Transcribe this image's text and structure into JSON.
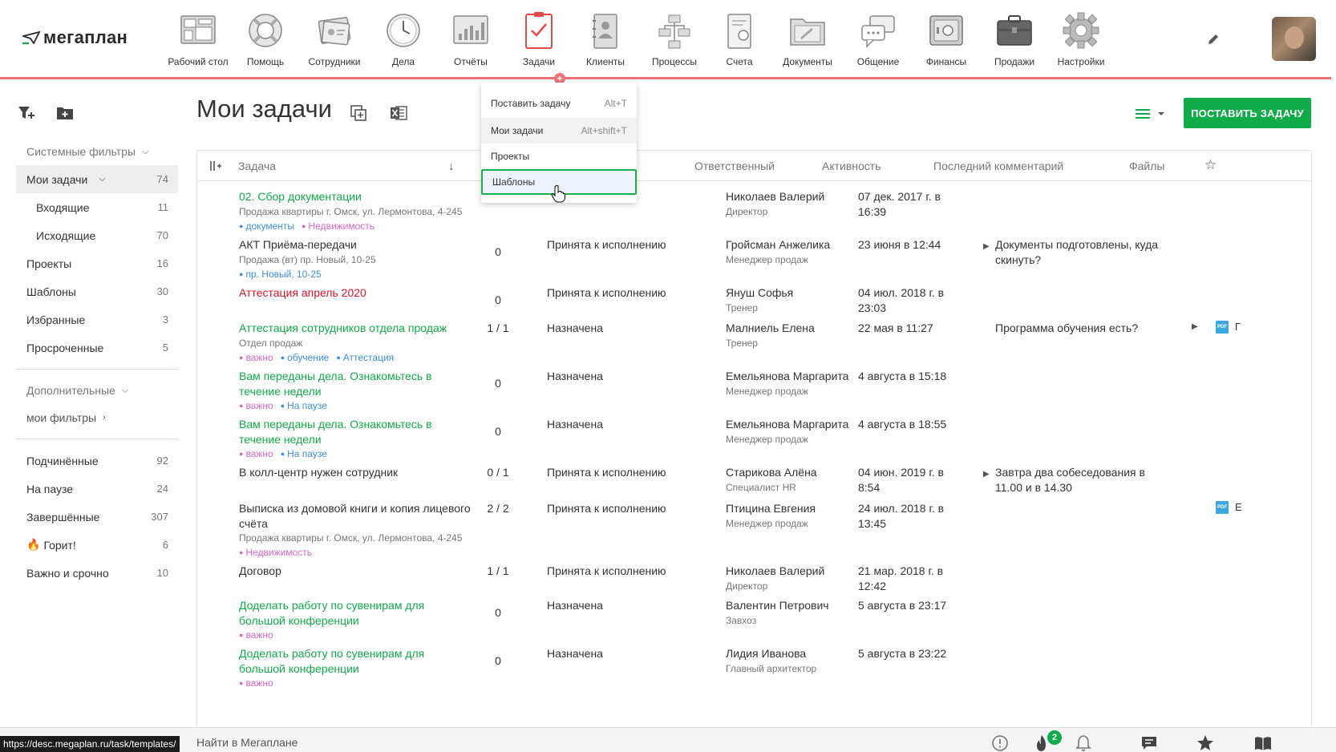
{
  "app": {
    "logo_text": "мегаплан"
  },
  "nav": [
    {
      "label": "Рабочий стол",
      "icon": "desktop-icon"
    },
    {
      "label": "Помощь",
      "icon": "lifebuoy-icon"
    },
    {
      "label": "Сотрудники",
      "icon": "employees-icon"
    },
    {
      "label": "Дела",
      "icon": "clock-icon"
    },
    {
      "label": "Отчёты",
      "icon": "reports-icon"
    },
    {
      "label": "Задачи",
      "icon": "tasks-icon"
    },
    {
      "label": "Клиенты",
      "icon": "clients-icon"
    },
    {
      "label": "Процессы",
      "icon": "processes-icon"
    },
    {
      "label": "Счета",
      "icon": "invoices-icon"
    },
    {
      "label": "Документы",
      "icon": "documents-icon"
    },
    {
      "label": "Общение",
      "icon": "chat-icon"
    },
    {
      "label": "Финансы",
      "icon": "safe-icon"
    },
    {
      "label": "Продажи",
      "icon": "briefcase-icon"
    },
    {
      "label": "Настройки",
      "icon": "gear-icon"
    }
  ],
  "sidebar": {
    "system_filters": "Системные фильтры",
    "my_tasks": {
      "label": "Мои задачи",
      "count": "74"
    },
    "inbox": {
      "label": "Входящие",
      "count": "11"
    },
    "outbox": {
      "label": "Исходящие",
      "count": "70"
    },
    "projects": {
      "label": "Проекты",
      "count": "16"
    },
    "templates": {
      "label": "Шаблоны",
      "count": "30"
    },
    "favorites": {
      "label": "Избранные",
      "count": "3"
    },
    "overdue": {
      "label": "Просроченные",
      "count": "5"
    },
    "extra": "Дополнительные",
    "my_filters": "мои фильтры",
    "subordinates": {
      "label": "Подчинённые",
      "count": "92"
    },
    "paused": {
      "label": "На паузе",
      "count": "24"
    },
    "done": {
      "label": "Завершённые",
      "count": "307"
    },
    "burning": {
      "label": "Горит!",
      "count": "6"
    },
    "urgent": {
      "label": "Важно и срочно",
      "count": "10"
    }
  },
  "header": {
    "title": "Мои задачи",
    "add_button": "ПОСТАВИТЬ ЗАДАЧУ"
  },
  "columns": {
    "task": "Задача",
    "responsible": "Ответственный",
    "activity": "Активность",
    "last_comment": "Последний комментарий",
    "files": "Файлы"
  },
  "dropdown": [
    {
      "label": "Поставить задачу",
      "hotkey": "Alt+T"
    },
    {
      "label": "Мои задачи",
      "hotkey": "Alt+shift+T"
    },
    {
      "label": "Проекты",
      "hotkey": ""
    },
    {
      "label": "Шаблоны",
      "hotkey": ""
    }
  ],
  "rows": [
    {
      "title": "02. Сбор документации",
      "style": "green",
      "sub": "Продажа квартиры г. Омск, ул. Лермонтова, 4-245",
      "tags": [
        {
          "t": "документы",
          "c": "blue"
        },
        {
          "t": "Недвижимость",
          "c": "pink"
        }
      ],
      "subtasks": "",
      "status": "",
      "resp": "Николаев Валерий",
      "role": "Директор",
      "act": "07 дек. 2017 г. в 16:39",
      "comment": "",
      "file": ""
    },
    {
      "title": "АКТ Приёма-передачи",
      "style": "",
      "sub": "Продажа (вт) пр. Новый, 10-25",
      "tags": [
        {
          "t": "пр. Новый, 10-25",
          "c": "blue"
        }
      ],
      "subtasks": "0",
      "status": "Принята к исполнению",
      "resp": "Гройсман Анжелика",
      "role": "Менеджер продаж",
      "act": "23 июня в 12:44",
      "comment": "Документы подготовлены, куда скинуть?",
      "file": ""
    },
    {
      "title": "Аттестация апрель 2020",
      "style": "red",
      "sub": "",
      "tags": [],
      "subtasks": "0",
      "status": "Принята к исполнению",
      "resp": "Януш Софья",
      "role": "Тренер",
      "act": "04 июл. 2018 г. в 23:03",
      "comment": "",
      "file": ""
    },
    {
      "title": "Аттестация сотрудников отдела продаж",
      "style": "green",
      "sub": "Отдел продаж",
      "tags": [
        {
          "t": "важно",
          "c": "pink"
        },
        {
          "t": "обучение",
          "c": "blue"
        },
        {
          "t": "Аттестация",
          "c": "blue"
        }
      ],
      "subtasks": "1 / 1",
      "status": "Назначена",
      "resp": "Малниель Елена",
      "role": "Тренер",
      "act": "22 мая в 11:27",
      "comment": "Программа обучения есть?",
      "file": "Г"
    },
    {
      "title": "Вам переданы дела. Ознакомьтесь в течение недели",
      "style": "green",
      "sub": "",
      "tags": [
        {
          "t": "важно",
          "c": "pink"
        },
        {
          "t": "На паузе",
          "c": "blue"
        }
      ],
      "subtasks": "0",
      "status": "Назначена",
      "resp": "Емельянова Маргарита",
      "role": "Менеджер продаж",
      "act": "4 августа в 15:18",
      "comment": "",
      "file": ""
    },
    {
      "title": "Вам переданы дела. Ознакомьтесь в течение недели",
      "style": "green",
      "sub": "",
      "tags": [
        {
          "t": "важно",
          "c": "pink"
        },
        {
          "t": "На паузе",
          "c": "blue"
        }
      ],
      "subtasks": "0",
      "status": "Назначена",
      "resp": "Емельянова Маргарита",
      "role": "Менеджер продаж",
      "act": "4 августа в 18:55",
      "comment": "",
      "file": ""
    },
    {
      "title": "В колл-центр нужен сотрудник",
      "style": "",
      "sub": "",
      "tags": [],
      "subtasks": "0 / 1",
      "status": "Принята к исполнению",
      "resp": "Старикова Алёна",
      "role": "Специалист HR",
      "act": "04 июн. 2019 г. в 8:54",
      "comment": "Завтра два собеседования в 11.00 и в 14.30",
      "file": ""
    },
    {
      "title": "Выписка из домовой книги и копия лицевого счёта",
      "style": "",
      "sub": "Продажа квартиры г. Омск, ул. Лермонтова, 4-245",
      "tags": [
        {
          "t": "Недвижимость",
          "c": "pink"
        }
      ],
      "subtasks": "2 / 2",
      "status": "Принята к исполнению",
      "resp": "Птицина Евгения",
      "role": "Менеджер продаж",
      "act": "24 июл. 2018 г. в 13:45",
      "comment": "",
      "file": "Е"
    },
    {
      "title": "Договор",
      "style": "",
      "sub": "",
      "tags": [],
      "subtasks": "1 / 1",
      "status": "Принята к исполнению",
      "resp": "Николаев Валерий",
      "role": "Директор",
      "act": "21 мар. 2018 г. в 12:42",
      "comment": "",
      "file": ""
    },
    {
      "title": "Доделать работу по сувенирам для большой конференции",
      "style": "green",
      "sub": "",
      "tags": [
        {
          "t": "важно",
          "c": "pink"
        }
      ],
      "subtasks": "0",
      "status": "Назначена",
      "resp": "Валентин Петрович",
      "role": "Завхоз",
      "act": "5 августа в 23:17",
      "comment": "",
      "file": ""
    },
    {
      "title": "Доделать работу по сувенирам для большой конференции",
      "style": "green",
      "sub": "",
      "tags": [
        {
          "t": "важно",
          "c": "pink"
        }
      ],
      "subtasks": "0",
      "status": "Назначена",
      "resp": "Лидия Иванова",
      "role": "Главный архитектор",
      "act": "5 августа в 23:22",
      "comment": "",
      "file": ""
    }
  ],
  "file_badge": "PDF",
  "bottom": {
    "url": "https://desc.megaplan.ru/task/templates/",
    "search": "Найти в Мегаплане",
    "notif_count": "2"
  },
  "colors": {
    "accent": "#11ab4a",
    "topline": "#ec7277",
    "link_green": "#11ab4a",
    "overdue_red": "#e0132a"
  }
}
